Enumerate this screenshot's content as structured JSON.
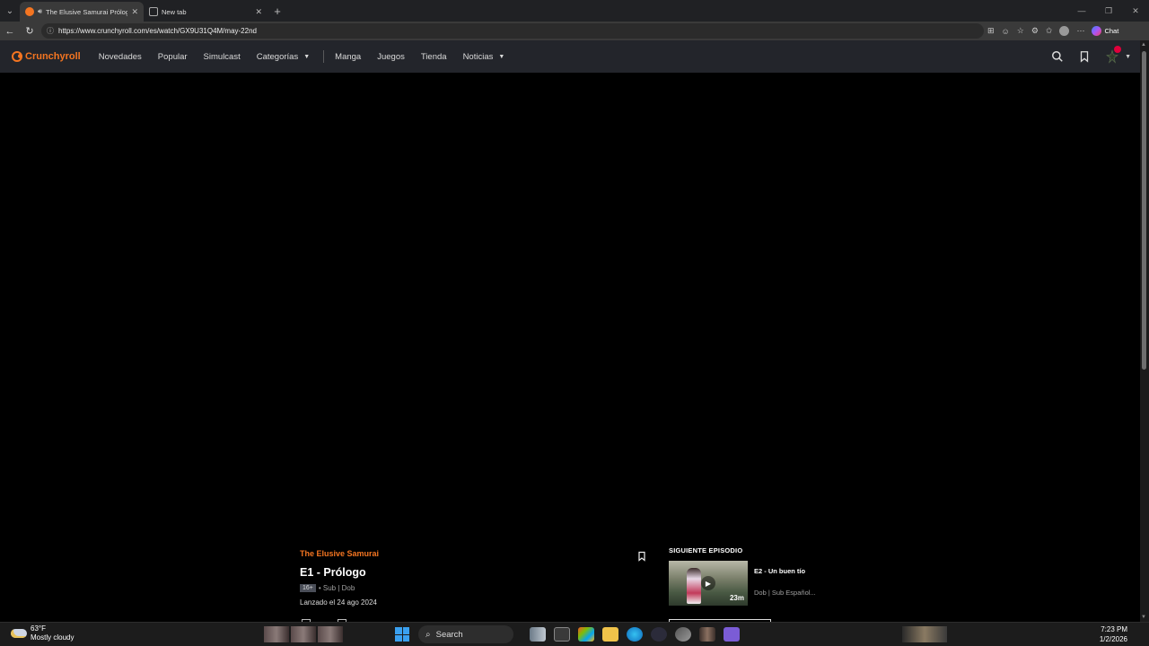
{
  "browser": {
    "tabs": [
      {
        "title": "The Elusive Samurai Prólogo",
        "active": true
      },
      {
        "title": "New tab",
        "active": false
      }
    ],
    "url": "https://www.crunchyroll.com/es/watch/GX9U31Q4M/may-22nd",
    "chat_label": "Chat"
  },
  "site": {
    "logo_text": "Crunchyroll",
    "nav": [
      {
        "label": "Novedades"
      },
      {
        "label": "Popular"
      },
      {
        "label": "Simulcast"
      },
      {
        "label": "Categorías"
      },
      {
        "label": "Manga"
      },
      {
        "label": "Juegos"
      },
      {
        "label": "Tienda"
      },
      {
        "label": "Noticias"
      }
    ]
  },
  "episode": {
    "series": "The Elusive Samurai",
    "title": "E1 - Prólogo",
    "rating": "16+",
    "audio": "• Sub | Dob",
    "release": "Lanzado el 24 ago 2024"
  },
  "next_episode": {
    "heading": "SIGUIENTE EPISODIO",
    "title": "E2 - Un buen tío",
    "duration": "23m",
    "meta": "Dob | Sub Español..."
  },
  "taskbar": {
    "temp": "63°F",
    "weather": "Mostly cloudy",
    "search": "Search",
    "time": "7:23 PM",
    "date": "1/2/2026"
  },
  "colors": {
    "accent": "#f47521",
    "header_bg": "#23252b",
    "notification": "#e0003b"
  }
}
